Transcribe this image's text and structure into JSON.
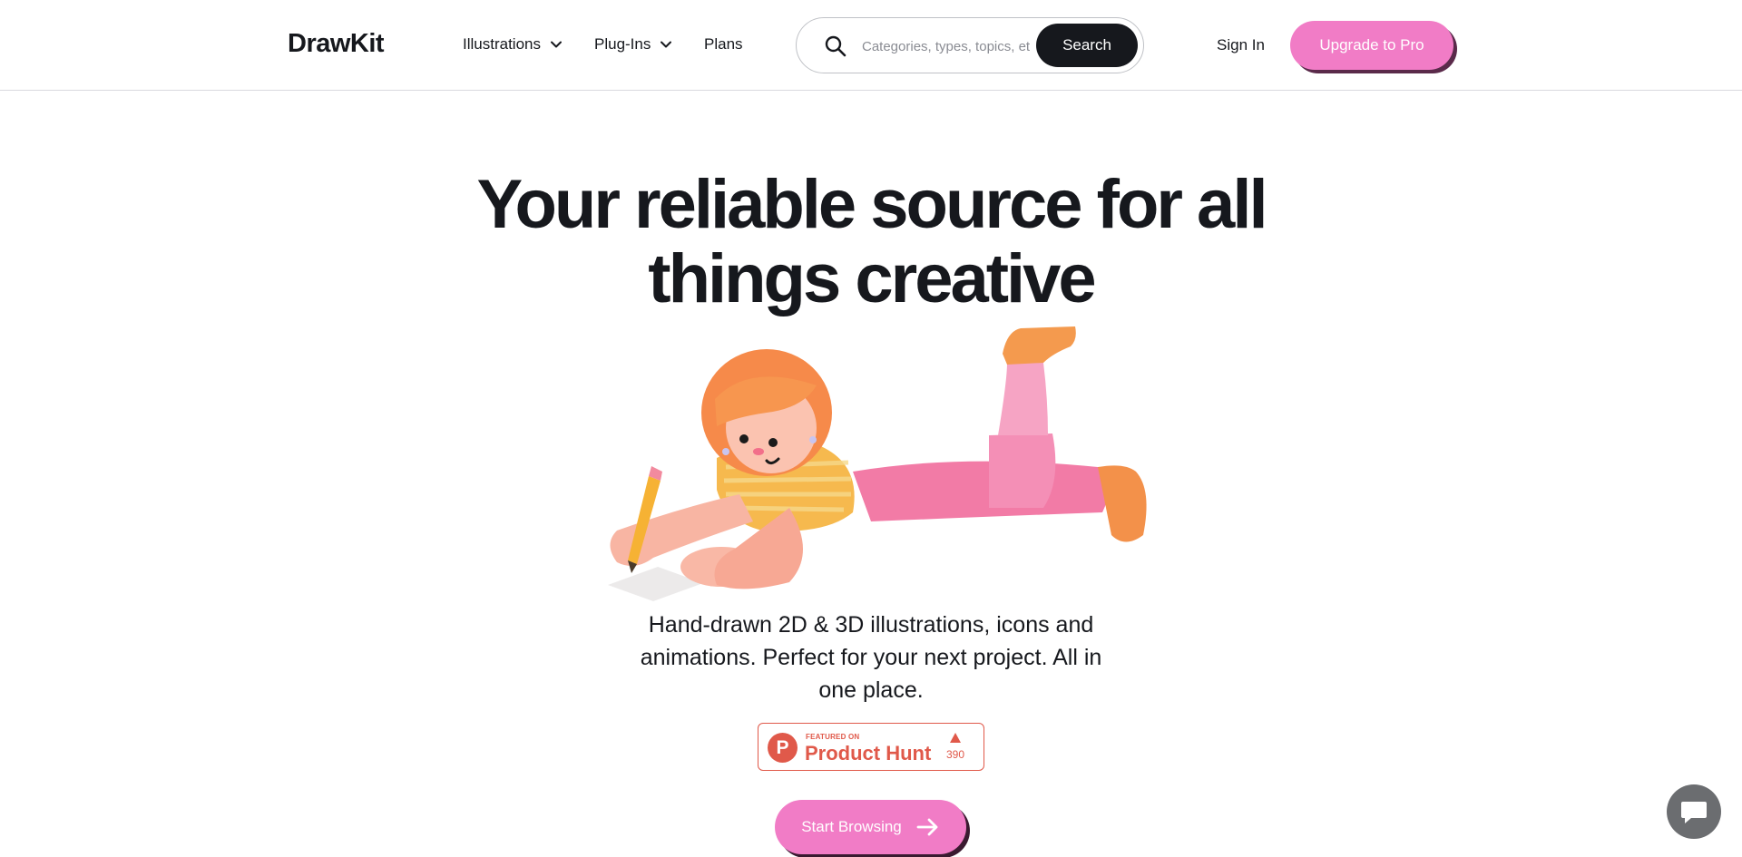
{
  "header": {
    "logo": "DrawKit",
    "nav": [
      {
        "label": "Illustrations",
        "has_dropdown": true
      },
      {
        "label": "Plug-Ins",
        "has_dropdown": true
      },
      {
        "label": "Plans",
        "has_dropdown": false
      }
    ],
    "search": {
      "placeholder": "Categories, types, topics, etc",
      "button_label": "Search"
    },
    "sign_in": "Sign In",
    "upgrade": "Upgrade to Pro"
  },
  "hero": {
    "title_line1": "Your reliable source for all",
    "title_line2": "things creative",
    "subtitle": "Hand-drawn 2D & 3D illustrations, icons and animations. Perfect for your next project. All in one place.",
    "product_hunt": {
      "featured": "FEATURED ON",
      "name": "Product Hunt",
      "votes": "390"
    },
    "cta_label": "Start Browsing"
  },
  "colors": {
    "accent_pink": "#f17cc6",
    "dark": "#16181d",
    "product_hunt": "#e0594a",
    "chat": "#6b6d70"
  },
  "icons": [
    "search-icon",
    "chevron-down-icon",
    "arrow-right-icon",
    "chat-icon",
    "triangle-up-icon"
  ]
}
